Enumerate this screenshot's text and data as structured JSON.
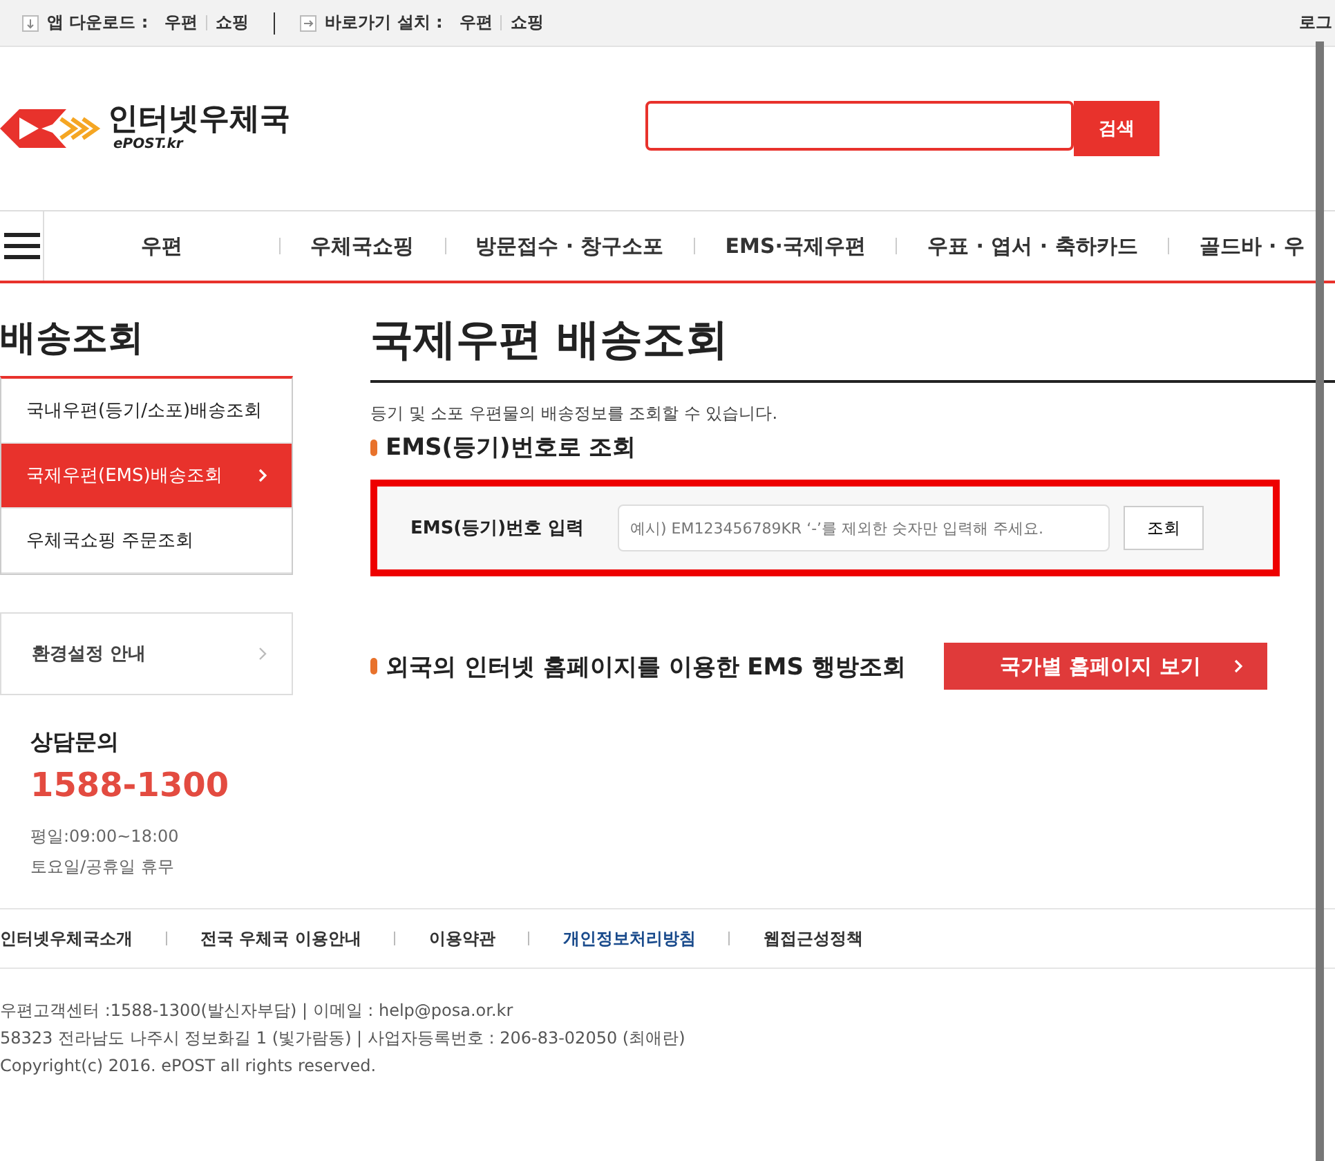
{
  "top_bar": {
    "groups": [
      {
        "label": "앱 다운로드 :",
        "links": [
          "우편",
          "쇼핑"
        ]
      },
      {
        "label": "바로가기 설치 :",
        "links": [
          "우편",
          "쇼핑"
        ]
      }
    ],
    "right_link": "로그"
  },
  "header": {
    "logo_text": "인터넷우체국",
    "logo_sub": "ePOST.kr",
    "search_button": "검색"
  },
  "nav": {
    "items": [
      "우편",
      "우체국쇼핑",
      "방문접수 · 창구소포",
      "EMS·국제우편",
      "우표 · 엽서 · 축하카드",
      "골드바 · 우"
    ]
  },
  "sidebar": {
    "title": "배송조회",
    "items": [
      {
        "label": "국내우편(등기/소포)배송조회",
        "selected": false
      },
      {
        "label": "국제우편(EMS)배송조회",
        "selected": true
      },
      {
        "label": "우체국쇼핑 주문조회",
        "selected": false
      }
    ],
    "settings_link": "환경설정 안내",
    "contact": {
      "title": "상담문의",
      "phone": "1588-1300",
      "hours": [
        "평일:09:00~18:00",
        "토요일/공휴일 휴무"
      ]
    }
  },
  "content": {
    "title": "국제우편 배송조회",
    "description": "등기 및 소포 우편물의 배송정보를 조회할 수 있습니다.",
    "section_title": "EMS(등기)번호로 조회",
    "form": {
      "label": "EMS(등기)번호 입력",
      "placeholder": "예시) EM123456789KR ‘-’를 제외한 숫자만 입력해 주세요.",
      "button": "조회"
    },
    "foreign_title": "외국의 인터넷 홈페이지를 이용한 EMS 행방조회",
    "foreign_button": "국가별 홈페이지 보기"
  },
  "footer": {
    "links": [
      {
        "label": "인터넷우체국소개",
        "emphasized": false
      },
      {
        "label": "전국 우체국 이용안내",
        "emphasized": false
      },
      {
        "label": "이용약관",
        "emphasized": false
      },
      {
        "label": "개인정보처리방침",
        "emphasized": true
      },
      {
        "label": "웹접근성정책",
        "emphasized": false
      }
    ],
    "lines": [
      "우편고객센터 :1588-1300(발신자부담)  |  이메일 : help@posa.or.kr",
      "58323 전라남도 나주시 정보화길 1 (빛가람동)  |  사업자등록번호 : 206-83-02050 (최애란)",
      "Copyright(c) 2016. ePOST all rights reserved."
    ]
  }
}
